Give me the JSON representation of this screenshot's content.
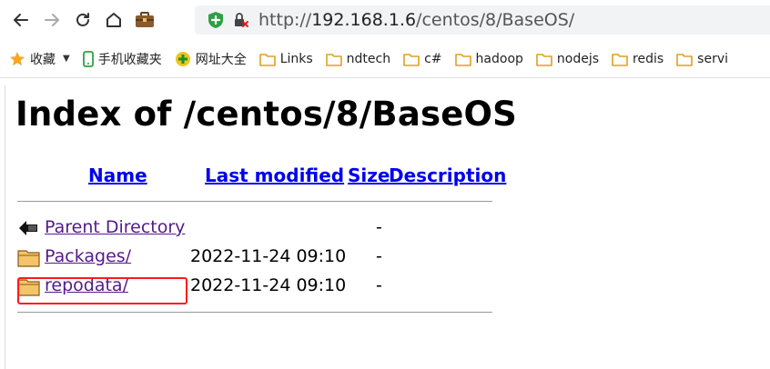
{
  "browser": {
    "url_prefix": "http://",
    "url_host": "192.168.1.6",
    "url_path": "/centos/8/BaseOS/"
  },
  "bookmarks": {
    "favorites": "收藏",
    "items": [
      "手机收藏夹",
      "网址大全",
      "Links",
      "ndtech",
      "c#",
      "hadoop",
      "nodejs",
      "redis",
      "servi"
    ]
  },
  "page": {
    "title": "Index of /centos/8/BaseOS",
    "columns": {
      "name": "Name",
      "last_modified": "Last modified",
      "size": "Size",
      "description": "Description"
    },
    "rows": [
      {
        "name": "Parent Directory",
        "date": "",
        "size": "-"
      },
      {
        "name": "Packages/",
        "date": "2022-11-24 09:10",
        "size": "-"
      },
      {
        "name": "repodata/",
        "date": "2022-11-24 09:10",
        "size": "-"
      }
    ]
  },
  "colors": {
    "link": "#0000ee",
    "visited": "#551a8b",
    "highlight": "#ff1a1a"
  }
}
